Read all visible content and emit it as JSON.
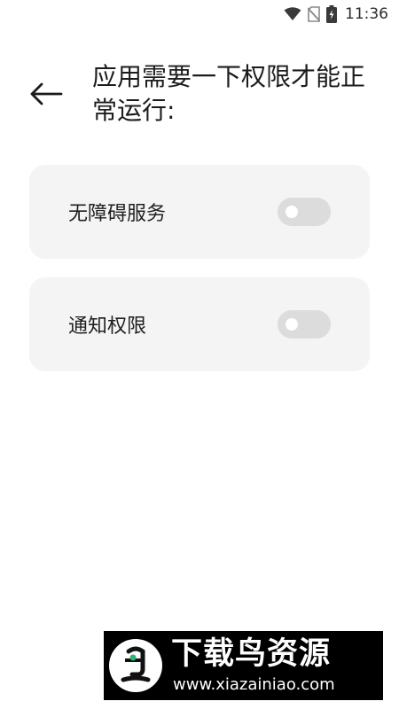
{
  "status_bar": {
    "time": "11:36",
    "icons": [
      "wifi-icon",
      "no-sim-icon",
      "battery-charging-icon"
    ]
  },
  "header": {
    "back_icon": "arrow-left-icon",
    "title": "应用需要一下权限才能正常运行:"
  },
  "permissions": [
    {
      "label": "无障碍服务",
      "enabled": false
    },
    {
      "label": "通知权限",
      "enabled": false
    }
  ],
  "watermark": {
    "title": "下载鸟资源",
    "url": "www.xiazainiao.com"
  },
  "colors": {
    "card_background": "#f4f4f4",
    "toggle_off": "#dcdcdc",
    "text": "#1c1c1c"
  }
}
